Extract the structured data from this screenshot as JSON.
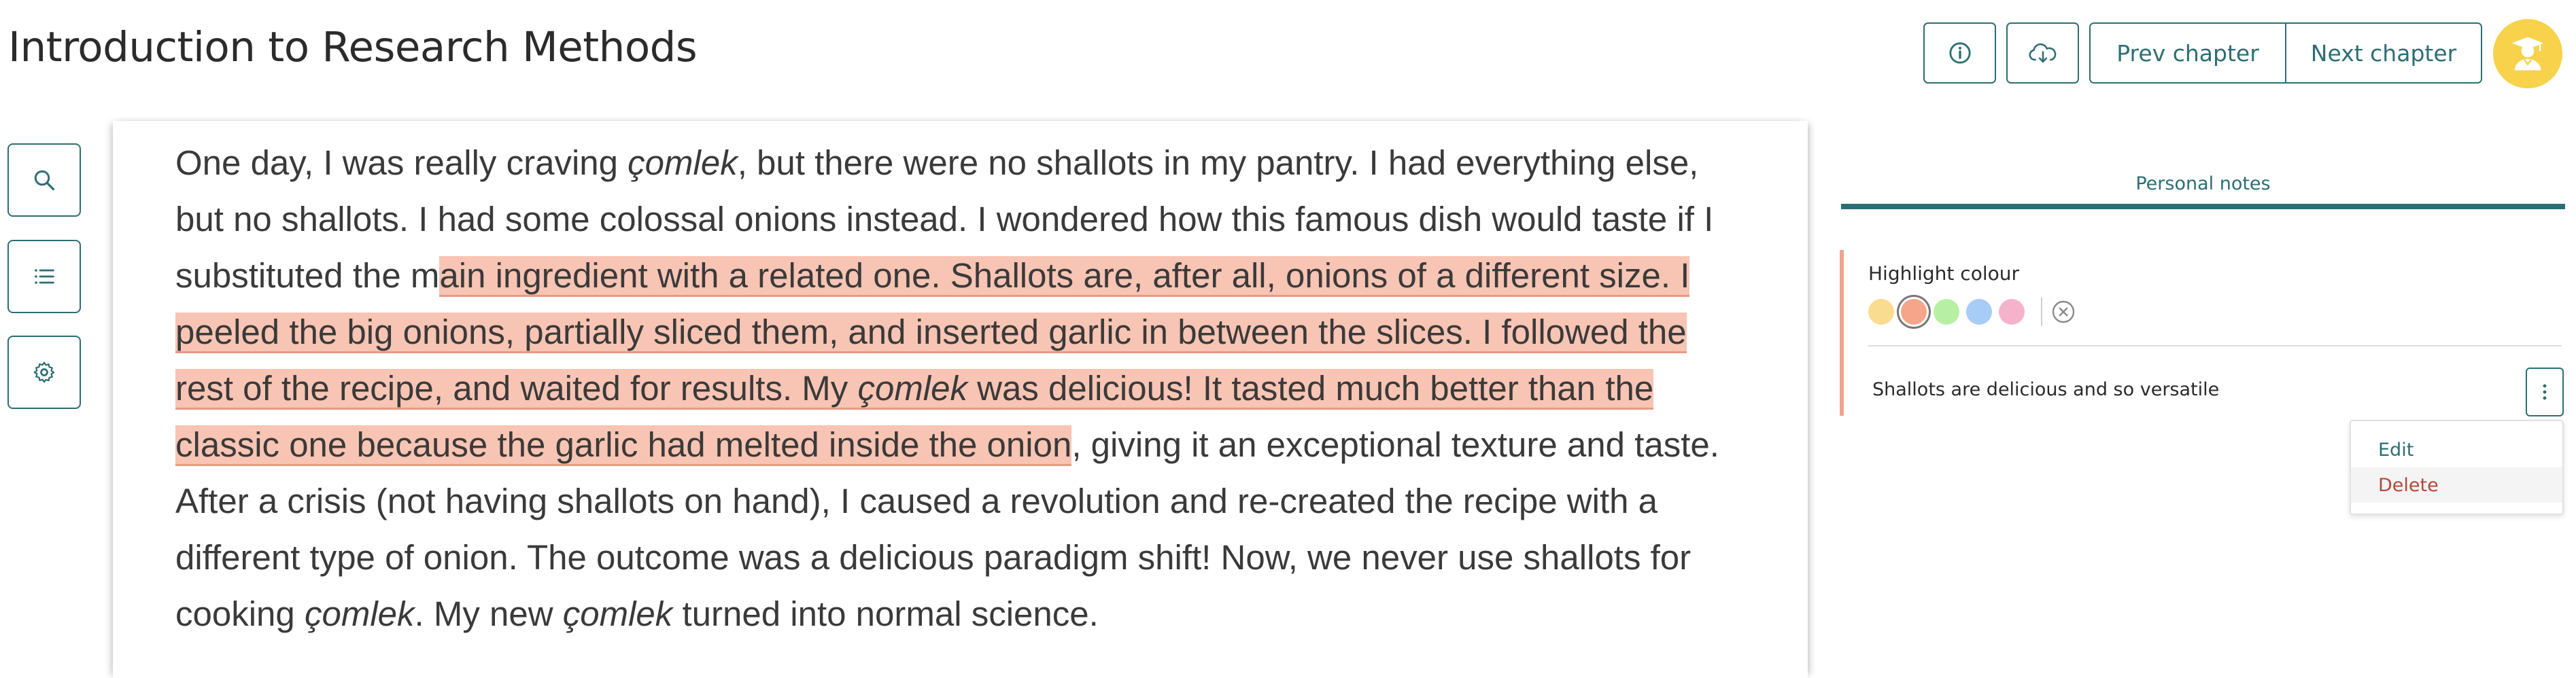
{
  "header": {
    "title": "Introduction to Research Methods",
    "info_icon": "info-circle-icon",
    "download_icon": "cloud-download-icon",
    "prev_chapter_label": "Prev chapter",
    "next_chapter_label": "Next chapter",
    "avatar_icon": "graduate-user-icon",
    "accent_color": "#2c6e73",
    "avatar_color": "#f7d24a"
  },
  "sidebar": {
    "items": [
      {
        "icon": "search-icon"
      },
      {
        "icon": "list-icon"
      },
      {
        "icon": "gear-icon"
      }
    ]
  },
  "reader": {
    "p1": "One day, I was really craving ",
    "i1": "çomlek",
    "p2": ", but there were no shallots in my pantry. I had everything else, but no shallots. I had some colossal onions instead. I wondered how this famous dish would taste if I substituted the m",
    "h1": "ain ingredient with a related one. Shallots are, after all, onions of a different size. I peeled the big onions, partially sliced them, and inserted garlic in between the slices. I followed the rest of the recipe, and waited for results. My ",
    "hi": "çomlek",
    "h2": " was delicious! It tasted much better than the classic one because the garlic had melted inside the onion",
    "p3": ", giving it an exceptional texture and taste. After a crisis (not having shallots on hand), I caused a revolution and re-created the recipe with a different type of onion. The outcome was a delicious paradigm shift! Now, we never use shallots for cooking ",
    "i2": "çomlek",
    "p4": ". My new ",
    "i3": "çomlek",
    "p5": " turned into normal science.",
    "highlight_color": "#f8c4b3"
  },
  "notes": {
    "tab_label": "Personal notes",
    "highlight_colour_label": "Highlight colour",
    "swatches": [
      "#f9dc8f",
      "#f6a58a",
      "#b8f0a3",
      "#a7cdf6",
      "#f5b3cb"
    ],
    "selected_swatch": 1,
    "clear_icon": "close-circle-icon",
    "note_text": "Shallots are delicious and so versatile",
    "more_icon": "vertical-ellipsis-icon",
    "menu": {
      "edit_label": "Edit",
      "delete_label": "Delete"
    }
  }
}
